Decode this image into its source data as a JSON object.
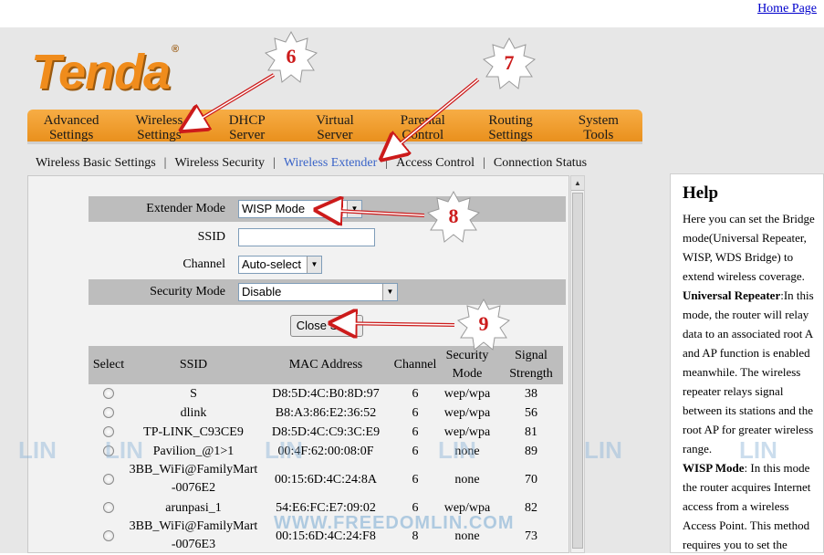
{
  "header": {
    "home_link": "Home Page"
  },
  "brand": {
    "logo_text": "Tenda",
    "logo_mark": "®"
  },
  "main_nav": [
    {
      "line1": "Advanced",
      "line2": "Settings"
    },
    {
      "line1": "Wireless",
      "line2": "Settings"
    },
    {
      "line1": "DHCP",
      "line2": "Server"
    },
    {
      "line1": "Virtual",
      "line2": "Server"
    },
    {
      "line1": "Parental",
      "line2": "Control"
    },
    {
      "line1": "Routing",
      "line2": "Settings"
    },
    {
      "line1": "System",
      "line2": "Tools"
    }
  ],
  "sub_nav": [
    {
      "label": "Wireless Basic Settings"
    },
    {
      "label": "Wireless Security"
    },
    {
      "label": "Wireless Extender",
      "active": true
    },
    {
      "label": "Access Control"
    },
    {
      "label": "Connection Status"
    }
  ],
  "sub_nav_separator": "|",
  "form": {
    "extender_mode": {
      "label": "Extender Mode",
      "value": "WISP Mode"
    },
    "ssid": {
      "label": "SSID",
      "value": ""
    },
    "channel": {
      "label": "Channel",
      "value": "Auto-select"
    },
    "security_mode": {
      "label": "Security Mode",
      "value": "Disable"
    },
    "close_scan_label": "Close Scan"
  },
  "scan_table": {
    "headers": {
      "select": "Select",
      "ssid": "SSID",
      "mac": "MAC Address",
      "channel": "Channel",
      "security_1": "Security",
      "security_2": "Mode",
      "signal_1": "Signal",
      "signal_2": "Strength"
    },
    "rows": [
      {
        "ssid": "S",
        "ssid2": "",
        "mac": "D8:5D:4C:B0:8D:97",
        "channel": "6",
        "security": "wep/wpa",
        "signal": "38"
      },
      {
        "ssid": "dlink",
        "ssid2": "",
        "mac": "B8:A3:86:E2:36:52",
        "channel": "6",
        "security": "wep/wpa",
        "signal": "56"
      },
      {
        "ssid": "TP-LINK_C93CE9",
        "ssid2": "",
        "mac": "D8:5D:4C:C9:3C:E9",
        "channel": "6",
        "security": "wep/wpa",
        "signal": "81"
      },
      {
        "ssid": "Pavilion_@1>1",
        "ssid2": "",
        "mac": "00:4F:62:00:08:0F",
        "channel": "6",
        "security": "none",
        "signal": "89"
      },
      {
        "ssid": "3BB_WiFi@FamilyMart",
        "ssid2": "-0076E2",
        "mac": "00:15:6D:4C:24:8A",
        "channel": "6",
        "security": "none",
        "signal": "70"
      },
      {
        "ssid": "arunpasi_1",
        "ssid2": "",
        "mac": "54:E6:FC:E7:09:02",
        "channel": "6",
        "security": "wep/wpa",
        "signal": "82"
      },
      {
        "ssid": "3BB_WiFi@FamilyMart",
        "ssid2": "-0076E3",
        "mac": "00:15:6D:4C:24:F8",
        "channel": "8",
        "security": "none",
        "signal": "73"
      }
    ]
  },
  "help": {
    "title": "Help",
    "lines": [
      "Here you can set the Bridge",
      "mode(Universal Repeater,",
      "WISP, WDS Bridge) to",
      "extend wireless coverage.",
      {
        "bold": "Universal Repeater",
        "rest": ":In this"
      },
      "mode, the router will relay",
      "data to an associated root A",
      "and AP function is enabled",
      "meanwhile. The wireless",
      "repeater relays signal",
      "between its stations and the",
      "root AP for greater wireless",
      "range.",
      {
        "bold": "WISP Mode",
        "rest": ": In this mode"
      },
      "the router acquires Internet",
      "access from a wireless",
      "Access Point. This method",
      "requires you to set the"
    ]
  },
  "callouts": [
    "6",
    "7",
    "8",
    "9"
  ],
  "watermark": {
    "site": "WWW.FREEDOMLIN.COM",
    "logo": "LIN"
  },
  "colors": {
    "nav_orange": "#f0a030",
    "active_link": "#3a64c8",
    "callout_red": "#cc1b1b",
    "logo_orange": "#f08c1c"
  }
}
